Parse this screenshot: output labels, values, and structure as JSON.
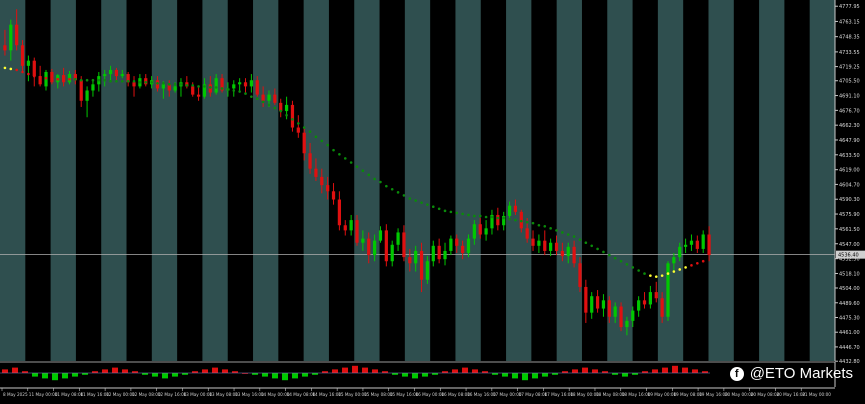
{
  "watermark": {
    "icon": "facebook-icon",
    "text": "@ETO Markets"
  },
  "colors": {
    "background": "#000000",
    "band": "#2f4f4f",
    "bull": "#00c800",
    "bear": "#e01010",
    "ma": "#0a8a0a",
    "ma_signal": "#ffff33",
    "grid": "#c8c8c8"
  },
  "chart_data": [
    {
      "type": "candlestick",
      "title": "",
      "ylim": [
        4433,
        4784
      ],
      "yticks": [
        "4777.95",
        "4763.15",
        "4748.35",
        "4733.55",
        "4719.25",
        "4705.50",
        "4691.10",
        "4676.70",
        "4662.30",
        "4647.90",
        "4633.50",
        "4619.00",
        "4604.70",
        "4590.30",
        "4575.90",
        "4561.50",
        "4547.00",
        "4532.50",
        "4518.10",
        "4504.00",
        "4489.60",
        "4475.30",
        "4461.00",
        "4446.70",
        "4432.80"
      ],
      "current_price": "4536.40",
      "current_price_value": 4536.4,
      "x_labels": [
        "8 May 2025",
        "11 May 00:00",
        "11 May 08:00",
        "11 May 16:00",
        "12 May 00:00",
        "12 May 08:00",
        "12 May 16:00",
        "13 May 00:00",
        "13 May 08:00",
        "13 May 16:00",
        "14 May 00:00",
        "14 May 08:00",
        "14 May 16:00",
        "15 May 00:00",
        "15 May 08:00",
        "15 May 16:00",
        "16 May 00:00",
        "16 May 08:00",
        "16 May 16:00",
        "17 May 00:00",
        "17 May 08:00",
        "17 May 16:00",
        "18 May 00:00",
        "18 May 08:00",
        "18 May 16:00",
        "19 May 00:00",
        "19 May 08:00",
        "19 May 16:00",
        "20 May 00:00",
        "20 May 08:00",
        "20 May 16:00",
        "21 May 00:00"
      ],
      "session_bands": 17,
      "candles": [
        [
          4740,
          4755,
          4730,
          4735
        ],
        [
          4735,
          4765,
          4725,
          4760
        ],
        [
          4760,
          4775,
          4735,
          4740
        ],
        [
          4740,
          4745,
          4715,
          4720
        ],
        [
          4720,
          4730,
          4705,
          4725
        ],
        [
          4725,
          4728,
          4700,
          4710
        ],
        [
          4710,
          4720,
          4700,
          4702
        ],
        [
          4700,
          4716,
          4696,
          4714
        ],
        [
          4714,
          4717,
          4702,
          4704
        ],
        [
          4704,
          4712,
          4698,
          4711
        ],
        [
          4711,
          4718,
          4700,
          4704
        ],
        [
          4704,
          4715,
          4702,
          4712
        ],
        [
          4712,
          4716,
          4702,
          4706
        ],
        [
          4706,
          4710,
          4680,
          4686
        ],
        [
          4686,
          4700,
          4670,
          4696
        ],
        [
          4696,
          4706,
          4690,
          4702
        ],
        [
          4702,
          4714,
          4695,
          4710
        ],
        [
          4710,
          4716,
          4700,
          4712
        ],
        [
          4712,
          4720,
          4706,
          4716
        ],
        [
          4716,
          4718,
          4705,
          4710
        ],
        [
          4710,
          4716,
          4708,
          4712
        ],
        [
          4712,
          4714,
          4700,
          4704
        ],
        [
          4704,
          4710,
          4690,
          4700
        ],
        [
          4700,
          4712,
          4698,
          4708
        ],
        [
          4708,
          4712,
          4700,
          4702
        ],
        [
          4702,
          4710,
          4698,
          4706
        ],
        [
          4706,
          4710,
          4695,
          4698
        ],
        [
          4698,
          4705,
          4688,
          4702
        ],
        [
          4702,
          4706,
          4690,
          4696
        ],
        [
          4696,
          4704,
          4694,
          4700
        ],
        [
          4700,
          4708,
          4690,
          4704
        ],
        [
          4704,
          4710,
          4698,
          4700
        ],
        [
          4700,
          4704,
          4690,
          4692
        ],
        [
          4692,
          4700,
          4686,
          4690
        ],
        [
          4690,
          4708,
          4688,
          4702
        ],
        [
          4702,
          4710,
          4690,
          4694
        ],
        [
          4694,
          4712,
          4692,
          4708
        ],
        [
          4708,
          4712,
          4694,
          4696
        ],
        [
          4696,
          4704,
          4690,
          4698
        ],
        [
          4698,
          4706,
          4690,
          4702
        ],
        [
          4702,
          4708,
          4696,
          4704
        ],
        [
          4704,
          4708,
          4694,
          4700
        ],
        [
          4700,
          4712,
          4694,
          4706
        ],
        [
          4706,
          4710,
          4690,
          4692
        ],
        [
          4692,
          4700,
          4680,
          4686
        ],
        [
          4686,
          4696,
          4680,
          4692
        ],
        [
          4692,
          4698,
          4682,
          4684
        ],
        [
          4684,
          4688,
          4670,
          4676
        ],
        [
          4676,
          4690,
          4668,
          4682
        ],
        [
          4682,
          4686,
          4656,
          4660
        ],
        [
          4660,
          4672,
          4650,
          4655
        ],
        [
          4655,
          4660,
          4628,
          4635
        ],
        [
          4635,
          4645,
          4615,
          4620
        ],
        [
          4620,
          4630,
          4608,
          4612
        ],
        [
          4612,
          4620,
          4596,
          4604
        ],
        [
          4604,
          4612,
          4590,
          4598
        ],
        [
          4598,
          4606,
          4585,
          4590
        ],
        [
          4590,
          4598,
          4560,
          4565
        ],
        [
          4565,
          4570,
          4555,
          4560
        ],
        [
          4560,
          4575,
          4555,
          4570
        ],
        [
          4570,
          4575,
          4545,
          4548
        ],
        [
          4548,
          4560,
          4540,
          4552
        ],
        [
          4552,
          4558,
          4528,
          4536
        ],
        [
          4536,
          4556,
          4530,
          4550
        ],
        [
          4550,
          4564,
          4548,
          4560
        ],
        [
          4560,
          4566,
          4525,
          4530
        ],
        [
          4530,
          4550,
          4525,
          4546
        ],
        [
          4546,
          4562,
          4540,
          4558
        ],
        [
          4558,
          4565,
          4530,
          4534
        ],
        [
          4534,
          4542,
          4520,
          4528
        ],
        [
          4528,
          4545,
          4520,
          4540
        ],
        [
          4540,
          4548,
          4500,
          4512
        ],
        [
          4512,
          4535,
          4508,
          4530
        ],
        [
          4530,
          4550,
          4525,
          4545
        ],
        [
          4545,
          4552,
          4528,
          4532
        ],
        [
          4532,
          4548,
          4526,
          4540
        ],
        [
          4540,
          4555,
          4536,
          4552
        ],
        [
          4552,
          4556,
          4538,
          4545
        ],
        [
          4545,
          4550,
          4532,
          4538
        ],
        [
          4538,
          4556,
          4534,
          4552
        ],
        [
          4552,
          4570,
          4546,
          4566
        ],
        [
          4566,
          4572,
          4552,
          4556
        ],
        [
          4556,
          4570,
          4550,
          4562
        ],
        [
          4562,
          4580,
          4556,
          4575
        ],
        [
          4575,
          4582,
          4560,
          4565
        ],
        [
          4565,
          4578,
          4560,
          4574
        ],
        [
          4574,
          4588,
          4570,
          4584
        ],
        [
          4584,
          4590,
          4575,
          4578
        ],
        [
          4578,
          4580,
          4558,
          4562
        ],
        [
          4562,
          4572,
          4548,
          4552
        ],
        [
          4552,
          4560,
          4540,
          4545
        ],
        [
          4545,
          4556,
          4538,
          4550
        ],
        [
          4550,
          4560,
          4536,
          4540
        ],
        [
          4540,
          4552,
          4535,
          4548
        ],
        [
          4548,
          4555,
          4536,
          4540
        ],
        [
          4540,
          4548,
          4530,
          4535
        ],
        [
          4535,
          4548,
          4528,
          4544
        ],
        [
          4544,
          4550,
          4524,
          4528
        ],
        [
          4528,
          4534,
          4500,
          4505
        ],
        [
          4505,
          4512,
          4470,
          4480
        ],
        [
          4480,
          4500,
          4474,
          4496
        ],
        [
          4496,
          4502,
          4480,
          4484
        ],
        [
          4484,
          4498,
          4476,
          4492
        ],
        [
          4492,
          4496,
          4470,
          4476
        ],
        [
          4476,
          4490,
          4470,
          4486
        ],
        [
          4486,
          4490,
          4462,
          4466
        ],
        [
          4466,
          4476,
          4458,
          4472
        ],
        [
          4472,
          4486,
          4466,
          4482
        ],
        [
          4482,
          4496,
          4476,
          4492
        ],
        [
          4492,
          4500,
          4484,
          4488
        ],
        [
          4488,
          4506,
          4484,
          4500
        ],
        [
          4500,
          4510,
          4490,
          4494
        ],
        [
          4494,
          4500,
          4470,
          4476
        ],
        [
          4476,
          4530,
          4472,
          4528
        ],
        [
          4528,
          4538,
          4520,
          4534
        ],
        [
          4534,
          4548,
          4530,
          4544
        ],
        [
          4544,
          4552,
          4538,
          4546
        ],
        [
          4546,
          4556,
          4540,
          4550
        ],
        [
          4550,
          4555,
          4538,
          4542
        ],
        [
          4542,
          4560,
          4538,
          4556
        ],
        [
          4556,
          4564,
          4530,
          4536
        ]
      ],
      "moving_average": [
        4718,
        4717,
        4716,
        4714,
        4712,
        4710,
        4709,
        4708,
        4708,
        4707,
        4707,
        4707,
        4707,
        4706,
        4706,
        4706,
        4706,
        4706,
        4705,
        4705,
        4705,
        4705,
        4705,
        4704,
        4704,
        4704,
        4703,
        4703,
        4702,
        4702,
        4702,
        4701,
        4701,
        4700,
        4700,
        4699,
        4699,
        4698,
        4697,
        4696,
        4695,
        4693,
        4690,
        4688,
        4685,
        4682,
        4679,
        4676,
        4672,
        4668,
        4664,
        4660,
        4656,
        4651,
        4647,
        4643,
        4638,
        4634,
        4630,
        4626,
        4622,
        4618,
        4614,
        4610,
        4607,
        4603,
        4600,
        4597,
        4594,
        4591,
        4589,
        4587,
        4585,
        4583,
        4581,
        4579,
        4578,
        4577,
        4576,
        4575,
        4574,
        4574,
        4573,
        4573,
        4572,
        4572,
        4571,
        4570,
        4569,
        4568,
        4567,
        4565,
        4564,
        4562,
        4560,
        4558,
        4556,
        4554,
        4551,
        4548,
        4545,
        4542,
        4539,
        4536,
        4533,
        4530,
        4527,
        4524,
        4521,
        4518,
        4516,
        4515,
        4516,
        4518,
        4520,
        4522,
        4524,
        4526,
        4528,
        4530
      ],
      "indicator": {
        "type": "histogram",
        "values": [
          2,
          3,
          1,
          -2,
          -3,
          -4,
          -3,
          -2,
          -1,
          1,
          2,
          3,
          2,
          1,
          -1,
          -2,
          -3,
          -2,
          -1,
          1,
          2,
          3,
          2,
          1,
          0,
          -1,
          -2,
          -3,
          -4,
          -3,
          -2,
          -1,
          1,
          2,
          3,
          4,
          3,
          2,
          1,
          -1,
          -2,
          -3,
          -2,
          -1,
          1,
          2,
          3,
          2,
          1,
          -1,
          -2,
          -3,
          -4,
          -3,
          -2,
          -1,
          1,
          2,
          3,
          2,
          1,
          -1,
          -2,
          -1,
          1,
          2,
          3,
          4,
          3,
          2,
          1
        ]
      }
    }
  ]
}
